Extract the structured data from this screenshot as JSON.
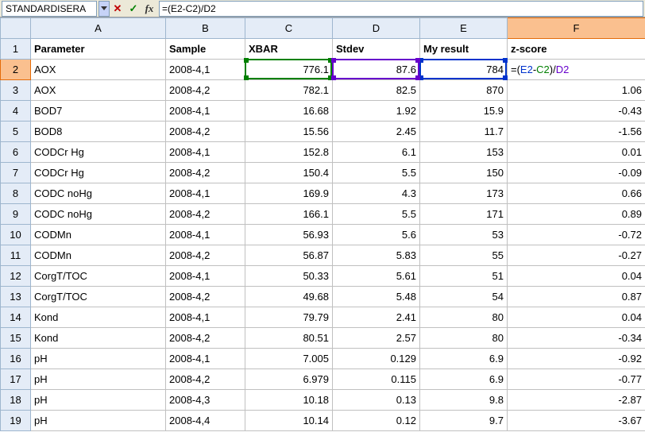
{
  "formula_bar": {
    "name_box": "STANDARDISERA",
    "formula": "=(E2-C2)/D2"
  },
  "columns": [
    "A",
    "B",
    "C",
    "D",
    "E",
    "F"
  ],
  "headers": {
    "A": "Parameter",
    "B": "Sample",
    "C": "XBAR",
    "D": "Stdev",
    "E": "My result",
    "F": "z-score"
  },
  "editing_cell_display": {
    "prefix": "=(",
    "ref1": "E2",
    "op1": "-",
    "ref2": "C2",
    "op2": ")/",
    "ref3": "D2"
  },
  "rows": [
    {
      "n": 2,
      "A": "AOX",
      "B": "2008-4,1",
      "C": "776.1",
      "D": "87.6",
      "E": "784",
      "F_edit": true
    },
    {
      "n": 3,
      "A": "AOX",
      "B": "2008-4,2",
      "C": "782.1",
      "D": "82.5",
      "E": "870",
      "F": "1.06"
    },
    {
      "n": 4,
      "A": "BOD7",
      "B": "2008-4,1",
      "C": "16.68",
      "D": "1.92",
      "E": "15.9",
      "F": "-0.43"
    },
    {
      "n": 5,
      "A": "BOD8",
      "B": "2008-4,2",
      "C": "15.56",
      "D": "2.45",
      "E": "11.7",
      "F": "-1.56"
    },
    {
      "n": 6,
      "A": "CODCr Hg",
      "B": "2008-4,1",
      "C": "152.8",
      "D": "6.1",
      "E": "153",
      "F": "0.01"
    },
    {
      "n": 7,
      "A": "CODCr Hg",
      "B": "2008-4,2",
      "C": "150.4",
      "D": "5.5",
      "E": "150",
      "F": "-0.09"
    },
    {
      "n": 8,
      "A": "CODC noHg",
      "B": "2008-4,1",
      "C": "169.9",
      "D": "4.3",
      "E": "173",
      "F": "0.66"
    },
    {
      "n": 9,
      "A": "CODC noHg",
      "B": "2008-4,2",
      "C": "166.1",
      "D": "5.5",
      "E": "171",
      "F": "0.89"
    },
    {
      "n": 10,
      "A": "CODMn",
      "B": "2008-4,1",
      "C": "56.93",
      "D": "5.6",
      "E": "53",
      "F": "-0.72"
    },
    {
      "n": 11,
      "A": "CODMn",
      "B": "2008-4,2",
      "C": "56.87",
      "D": "5.83",
      "E": "55",
      "F": "-0.27"
    },
    {
      "n": 12,
      "A": "CorgT/TOC",
      "B": "2008-4,1",
      "C": "50.33",
      "D": "5.61",
      "E": "51",
      "F": "0.04"
    },
    {
      "n": 13,
      "A": "CorgT/TOC",
      "B": "2008-4,2",
      "C": "49.68",
      "D": "5.48",
      "E": "54",
      "F": "0.87"
    },
    {
      "n": 14,
      "A": "Kond",
      "B": "2008-4,1",
      "C": "79.79",
      "D": "2.41",
      "E": "80",
      "F": "0.04"
    },
    {
      "n": 15,
      "A": "Kond",
      "B": "2008-4,2",
      "C": "80.51",
      "D": "2.57",
      "E": "80",
      "F": "-0.34"
    },
    {
      "n": 16,
      "A": "pH",
      "B": "2008-4,1",
      "C": "7.005",
      "D": "0.129",
      "E": "6.9",
      "F": "-0.92"
    },
    {
      "n": 17,
      "A": "pH",
      "B": "2008-4,2",
      "C": "6.979",
      "D": "0.115",
      "E": "6.9",
      "F": "-0.77"
    },
    {
      "n": 18,
      "A": "pH",
      "B": "2008-4,3",
      "C": "10.18",
      "D": "0.13",
      "E": "9.8",
      "F": "-2.87"
    },
    {
      "n": 19,
      "A": "pH",
      "B": "2008-4,4",
      "C": "10.14",
      "D": "0.12",
      "E": "9.7",
      "F": "-3.67"
    }
  ],
  "chart_data": {
    "type": "table",
    "title": "",
    "columns": [
      "Parameter",
      "Sample",
      "XBAR",
      "Stdev",
      "My result",
      "z-score"
    ],
    "data": [
      [
        "AOX",
        "2008-4,1",
        776.1,
        87.6,
        784,
        null
      ],
      [
        "AOX",
        "2008-4,2",
        782.1,
        82.5,
        870,
        1.06
      ],
      [
        "BOD7",
        "2008-4,1",
        16.68,
        1.92,
        15.9,
        -0.43
      ],
      [
        "BOD8",
        "2008-4,2",
        15.56,
        2.45,
        11.7,
        -1.56
      ],
      [
        "CODCr Hg",
        "2008-4,1",
        152.8,
        6.1,
        153,
        0.01
      ],
      [
        "CODCr Hg",
        "2008-4,2",
        150.4,
        5.5,
        150,
        -0.09
      ],
      [
        "CODC noHg",
        "2008-4,1",
        169.9,
        4.3,
        173,
        0.66
      ],
      [
        "CODC noHg",
        "2008-4,2",
        166.1,
        5.5,
        171,
        0.89
      ],
      [
        "CODMn",
        "2008-4,1",
        56.93,
        5.6,
        53,
        -0.72
      ],
      [
        "CODMn",
        "2008-4,2",
        56.87,
        5.83,
        55,
        -0.27
      ],
      [
        "CorgT/TOC",
        "2008-4,1",
        50.33,
        5.61,
        51,
        0.04
      ],
      [
        "CorgT/TOC",
        "2008-4,2",
        49.68,
        5.48,
        54,
        0.87
      ],
      [
        "Kond",
        "2008-4,1",
        79.79,
        2.41,
        80,
        0.04
      ],
      [
        "Kond",
        "2008-4,2",
        80.51,
        2.57,
        80,
        -0.34
      ],
      [
        "pH",
        "2008-4,1",
        7.005,
        0.129,
        6.9,
        -0.92
      ],
      [
        "pH",
        "2008-4,2",
        6.979,
        0.115,
        6.9,
        -0.77
      ],
      [
        "pH",
        "2008-4,3",
        10.18,
        0.13,
        9.8,
        -2.87
      ],
      [
        "pH",
        "2008-4,4",
        10.14,
        0.12,
        9.7,
        -3.67
      ]
    ]
  }
}
